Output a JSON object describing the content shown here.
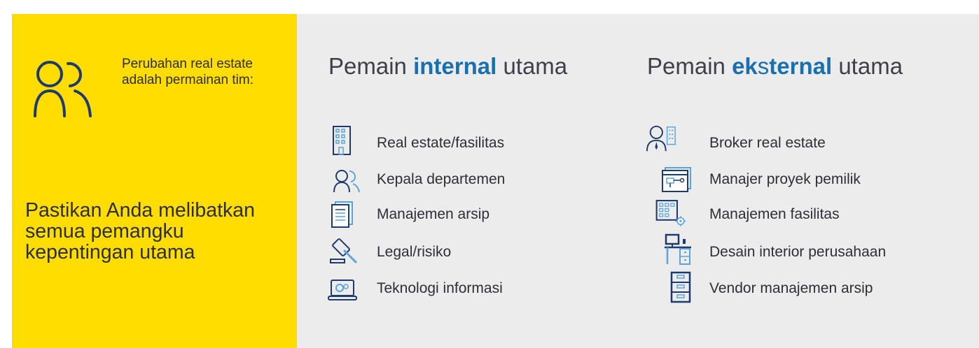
{
  "left_panel": {
    "team_text": "Perubahan real estate adalah permainan tim:",
    "cta_text": "Pastikan Anda melibatkan semua pemangku kepentingan utama"
  },
  "internal": {
    "heading_pre": "Pemain",
    "heading_highlight": "internal",
    "heading_post": "utama",
    "items": [
      {
        "label": "Real estate/fasilitas",
        "icon": "building-icon"
      },
      {
        "label": "Kepala departemen",
        "icon": "people-icon"
      },
      {
        "label": "Manajemen arsip",
        "icon": "documents-icon"
      },
      {
        "label": "Legal/risiko",
        "icon": "gavel-icon"
      },
      {
        "label": "Teknologi informasi",
        "icon": "laptop-gear-icon"
      }
    ]
  },
  "external": {
    "heading_pre": "Pemain",
    "heading_hl_a": "ek",
    "heading_mid": "s",
    "heading_hl_b": "ternal",
    "heading_post": "utama",
    "items": [
      {
        "label": "Broker real estate",
        "icon": "broker-icon"
      },
      {
        "label": "Manajer proyek pemilik",
        "icon": "project-window-icon"
      },
      {
        "label": "Manajemen fasilitas",
        "icon": "building-gear-icon"
      },
      {
        "label": "Desain interior perusahaan",
        "icon": "desk-icon"
      },
      {
        "label": "Vendor manajemen arsip",
        "icon": "cabinet-icon"
      }
    ]
  },
  "colors": {
    "yellow": "#FFDD00",
    "gray": "#ECECEC",
    "accent_blue": "#1A6FAF",
    "icon_navy": "#1F3A6E",
    "icon_light_blue": "#5BA3DC"
  }
}
